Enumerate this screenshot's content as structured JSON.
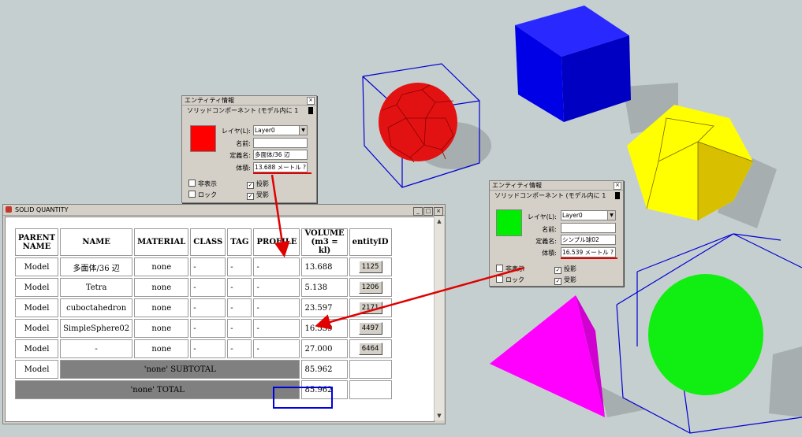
{
  "colors": {
    "background": "#c6cfd0",
    "red_solid": "#e00000",
    "blue_solid": "#0000e6",
    "yellow_solid": "#ffff00",
    "magenta_solid": "#ff00ff",
    "green_solid": "#11ee11",
    "annotation_red": "#e00000",
    "annotation_blue": "#0000e0"
  },
  "entity_panel_left": {
    "title": "エンティティ情報",
    "subtitle": "ソリッドコンポーネント (モデル内に 1",
    "swatch_color": "#ff0000",
    "layer_label": "レイヤ(L):",
    "layer_value": "Layer0",
    "name_label": "名前:",
    "name_value": "",
    "definition_label": "定義名:",
    "definition_value": "多面体/36 辺",
    "volume_label": "体積:",
    "volume_value": "13.688 メートル ?",
    "hidden_label": "非表示",
    "cast_shadow_label": "投影",
    "lock_label": "ロック",
    "receive_shadow_label": "受影"
  },
  "entity_panel_right": {
    "title": "エンティティ情報",
    "subtitle": "ソリッドコンポーネント (モデル内に 1",
    "swatch_color": "#00ee00",
    "layer_label": "レイヤ(L):",
    "layer_value": "Layer0",
    "name_label": "名前:",
    "name_value": "",
    "definition_label": "定義名:",
    "definition_value": "シンプル球02",
    "volume_label": "体積:",
    "volume_value": "16.539 メートル ?",
    "hidden_label": "非表示",
    "cast_shadow_label": "投影",
    "lock_label": "ロック",
    "receive_shadow_label": "受影"
  },
  "solid_quantity": {
    "title": "SOLID QUANTITY",
    "headers": {
      "parent": "PARENT NAME",
      "name": "NAME",
      "material": "MATERIAL",
      "class": "CLASS",
      "tag": "TAG",
      "profile": "PROFILE",
      "volume": "VOLUME (m3 = kl)",
      "entity": "entityID"
    },
    "rows": [
      {
        "parent": "Model",
        "name": "多面体/36 辺",
        "material": "none",
        "cls": "-",
        "tag": "-",
        "profile": "-",
        "volume": "13.688",
        "entity": "1125"
      },
      {
        "parent": "Model",
        "name": "Tetra",
        "material": "none",
        "cls": "-",
        "tag": "-",
        "profile": "-",
        "volume": "5.138",
        "entity": "1206"
      },
      {
        "parent": "Model",
        "name": "cuboctahedron",
        "material": "none",
        "cls": "-",
        "tag": "-",
        "profile": "-",
        "volume": "23.597",
        "entity": "2171"
      },
      {
        "parent": "Model",
        "name": "SimpleSphere02",
        "material": "none",
        "cls": "-",
        "tag": "-",
        "profile": "-",
        "volume": "16.539",
        "entity": "4497"
      },
      {
        "parent": "Model",
        "name": "-",
        "material": "none",
        "cls": "-",
        "tag": "-",
        "profile": "-",
        "volume": "27.000",
        "entity": "6464"
      }
    ],
    "subtotal": {
      "parent": "Model",
      "label": "'none' SUBTOTAL",
      "volume": "85.962"
    },
    "total": {
      "label": "'none' TOTAL",
      "volume": "85.962"
    }
  }
}
